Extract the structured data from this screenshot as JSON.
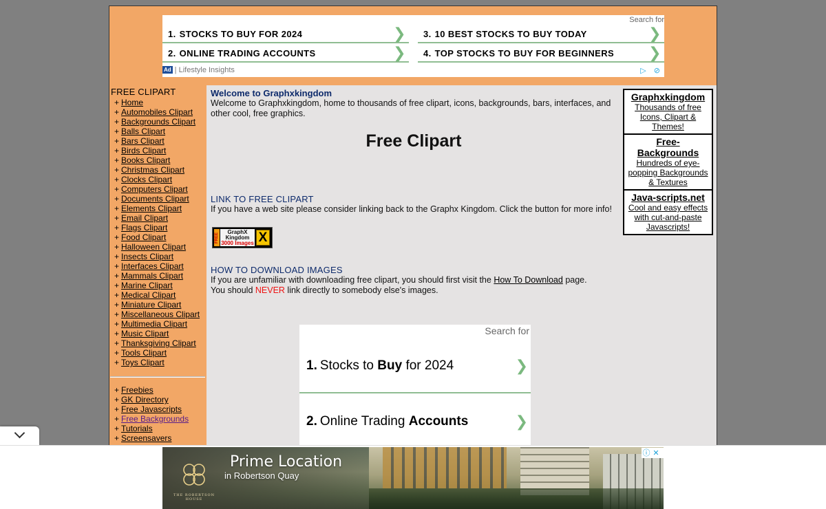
{
  "top_ad": {
    "search_for": "Search for",
    "items": [
      {
        "num": "1.",
        "label": "STOCKS TO BUY FOR 2024"
      },
      {
        "num": "3.",
        "label": "10 BEST STOCKS TO BUY TODAY"
      },
      {
        "num": "2.",
        "label": "ONLINE TRADING ACCOUNTS"
      },
      {
        "num": "4.",
        "label": "TOP STOCKS TO BUY FOR BEGINNERS"
      }
    ],
    "ad_badge": "Ad",
    "sponsor": "Lifestyle Insights"
  },
  "sidebar": {
    "heading": "FREE CLIPART",
    "items": [
      "Home",
      "Automobiles Clipart",
      "Backgrounds Clipart",
      "Balls Clipart",
      "Bars Clipart",
      "Birds Clipart",
      "Books Clipart",
      "Christmas Clipart",
      "Clocks Clipart",
      "Computers Clipart",
      "Documents Clipart",
      "Elements Clipart",
      "Email Clipart",
      "Flags Clipart",
      "Food Clipart",
      "Halloween Clipart",
      "Insects Clipart",
      "Interfaces Clipart",
      "Mammals Clipart",
      "Marine Clipart",
      "Medical Clipart",
      "Miniature Clipart",
      "Miscellaneous Clipart",
      "Multimedia Clipart",
      "Music Clipart",
      "Thanksgiving Clipart",
      "Tools Clipart",
      "Toys Clipart"
    ],
    "extras": [
      "Freebies",
      "GK Directory",
      "Free Javascripts",
      "Free Backgrounds",
      "Tutorials",
      "Screensavers"
    ]
  },
  "main": {
    "welcome_title": "Welcome to Graphxkingdom",
    "welcome_body": "Welcome to Graphxkingdom, home to thousands of free clipart, icons, backgrounds, bars, interfaces, and other cool, free graphics.",
    "page_title": "Free Clipart",
    "link_title": "LINK TO FREE CLIPART",
    "link_body": "If you have a web site please consider linking back to the Graphx Kingdom. Click the button for more info!",
    "badge": {
      "free": "FREE",
      "line1": "GraphX",
      "line2": "Kingdom",
      "line3": "3000 Images",
      "x": "X"
    },
    "download_title": "HOW TO DOWNLOAD IMAGES",
    "download_body_1": "If you are unfamiliar with downloading free clipart, you should first visit the ",
    "download_link": "How To Download",
    "download_body_2": " page.",
    "download_body_3": "You should ",
    "never": "NEVER",
    "download_body_4": " link directly to somebody else's images."
  },
  "mid_ad": {
    "search_for": "Search for",
    "items": [
      {
        "num": "1.",
        "pre": "Stocks to ",
        "bold": "Buy",
        "post": " for 2024"
      },
      {
        "num": "2.",
        "pre": "Online Trading ",
        "bold": "Accounts",
        "post": ""
      }
    ]
  },
  "right_boxes": [
    {
      "title": "Graphxkingdom",
      "desc": "Thousands of free Icons, Clipart & Themes!"
    },
    {
      "title": "Free-Backgrounds",
      "desc": "Hundreds of eye-popping Backgrounds & Textures"
    },
    {
      "title": "Java-scripts.net",
      "desc": "Cool and easy effects with cut-and-paste Javascripts!"
    }
  ],
  "banner_ad": {
    "title": "Prime Location",
    "subtitle": "in Robertson Quay",
    "logo_text": "THE ROBERTSON HOUSE"
  },
  "colors": {
    "orange": "#f2a766",
    "content_bg": "#e5e3e3",
    "title_blue": "#0d2a6b",
    "ad_green": "#8fbd92",
    "never_red": "#ee1111"
  }
}
